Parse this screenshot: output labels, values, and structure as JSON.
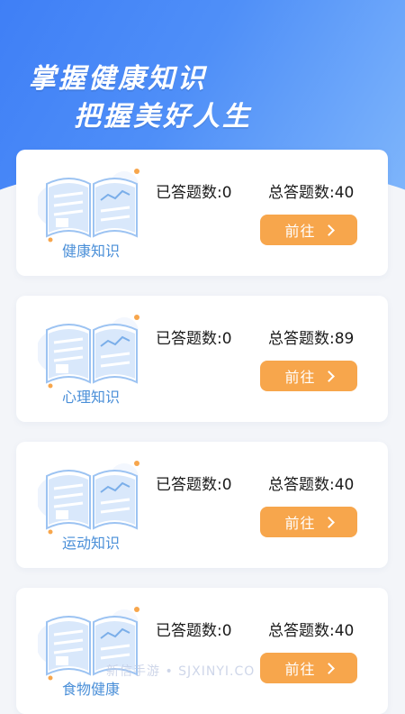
{
  "header": {
    "line1": "掌握健康知识",
    "line2": "把握美好人生"
  },
  "cards": [
    {
      "title": "健康知识",
      "answered": "已答题数:0",
      "total": "总答题数:40",
      "button": "前往"
    },
    {
      "title": "心理知识",
      "answered": "已答题数:0",
      "total": "总答题数:89",
      "button": "前往"
    },
    {
      "title": "运动知识",
      "answered": "已答题数:0",
      "total": "总答题数:40",
      "button": "前往"
    },
    {
      "title": "食物健康",
      "answered": "已答题数:0",
      "total": "总答题数:40",
      "button": "前往"
    }
  ],
  "watermark": "新信手游 • SJXINYI.CO",
  "colors": {
    "header_start": "#3f7ff6",
    "header_end": "#7fb6fb",
    "button": "#f7a64c",
    "card_title": "#4a8fd8",
    "background": "#f3f5f9"
  }
}
